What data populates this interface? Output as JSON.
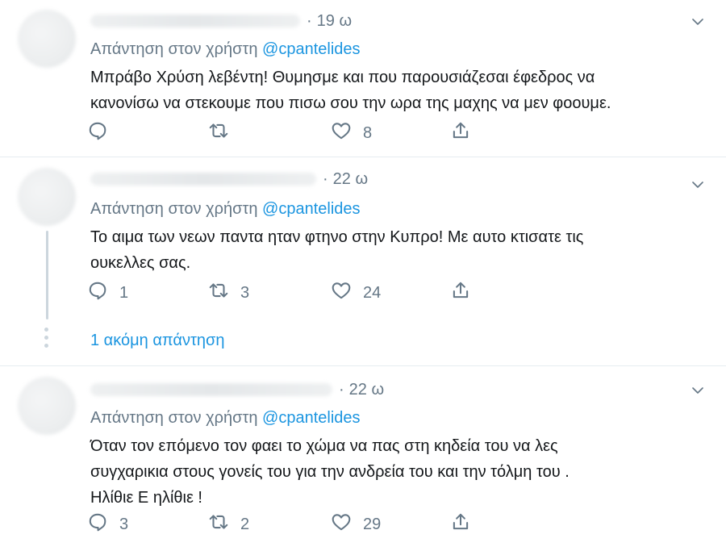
{
  "tweets": [
    {
      "time": "19 ω",
      "reply_prefix": "Απάντηση στον χρήστη",
      "reply_handle": "@cpantelides",
      "text_lines": [
        "Μπράβο Χρύση λεβέντη! Θυμησμε και που παρουσιάζεσαι έφεδρος να",
        "κανονίσω να στεκουμε που πισω σου την ωρα της μαχης να μεν φοουμε."
      ],
      "replies": "",
      "retweets": "",
      "likes": "8"
    },
    {
      "time": "22 ω",
      "reply_prefix": "Απάντηση στον χρήστη",
      "reply_handle": "@cpantelides",
      "text_lines": [
        "Το αιμα των νεων παντα ηταν φτηνο στην Κυπρο! Με αυτο κτισατε τις",
        "ουκελλες σας."
      ],
      "replies": "1",
      "retweets": "3",
      "likes": "24",
      "more_replies": "1 ακόμη απάντηση"
    },
    {
      "time": "22 ω",
      "reply_prefix": "Απάντηση στον χρήστη",
      "reply_handle": "@cpantelides",
      "text_lines": [
        "Όταν τον επόμενο τον φαει το χώμα να πας στη κηδεία του να λες",
        "συγχαρικια στους γονείς του για την ανδρεία του και την τόλμη του .",
        "Ηλίθιε Ε ηλίθιε !"
      ],
      "replies": "3",
      "retweets": "2",
      "likes": "29"
    }
  ],
  "icons": {
    "reply": "reply-icon",
    "retweet": "retweet-icon",
    "like": "heart-icon",
    "share": "share-icon",
    "menu": "chevron-down-icon"
  },
  "colors": {
    "link": "#1b95e0",
    "secondary_text": "#657786",
    "divider": "#e6ecf0"
  }
}
